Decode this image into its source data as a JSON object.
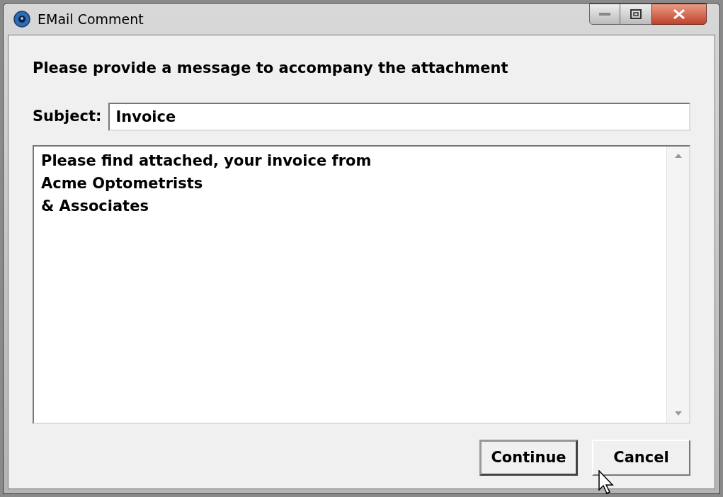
{
  "window": {
    "title": "EMail Comment"
  },
  "prompt": "Please provide a message to accompany the attachment",
  "subject": {
    "label": "Subject:",
    "value": "Invoice"
  },
  "message": {
    "value": "Please find attached, your invoice from\nAcme Optometrists\n& Associates"
  },
  "buttons": [
    {
      "label": "Continue",
      "default": true
    },
    {
      "label": "Cancel",
      "default": false
    }
  ]
}
